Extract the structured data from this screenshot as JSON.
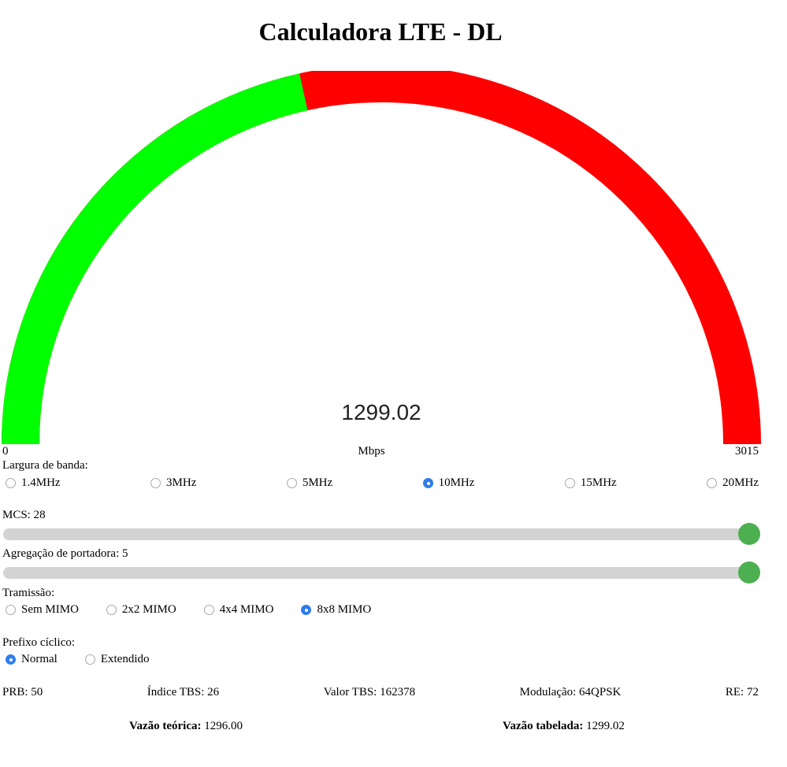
{
  "title": "Calculadora LTE - DL",
  "gauge": {
    "value": 1299.02,
    "display_value": "1299.02",
    "min_label": "0",
    "max_label": "3015",
    "min": 0,
    "max": 3015,
    "unit": "Mbps",
    "fill_color": "#00ff00",
    "remainder_color": "#ff0000"
  },
  "bandwidth": {
    "label": "Largura de banda:",
    "options": [
      "1.4MHz",
      "3MHz",
      "5MHz",
      "10MHz",
      "15MHz",
      "20MHz"
    ],
    "selected": "10MHz"
  },
  "mcs": {
    "label": "MCS: 28",
    "value": 28,
    "min": 0,
    "max": 28
  },
  "carrier_aggregation": {
    "label": "Agregação de portadora: 5",
    "value": 5,
    "min": 1,
    "max": 5
  },
  "transmission": {
    "label": "Tramissão:",
    "options": [
      "Sem MIMO",
      "2x2 MIMO",
      "4x4 MIMO",
      "8x8 MIMO"
    ],
    "selected": "8x8 MIMO"
  },
  "cyclic_prefix": {
    "label": "Prefixo cíclico:",
    "options": [
      "Normal",
      "Extendido"
    ],
    "selected": "Normal"
  },
  "stats": {
    "prb": "PRB: 50",
    "tbs_index": "Índice TBS: 26",
    "tbs_value": "Valor TBS: 162378",
    "modulation": "Modulação: 64QPSK",
    "re": "RE: 72"
  },
  "throughput": {
    "theoretical_label": "Vazão teórica:",
    "theoretical_value": "1296.00",
    "tabulated_label": "Vazão tabelada:",
    "tabulated_value": "1299.02"
  },
  "colors": {
    "accent": "#2f7dec",
    "slider_thumb": "#4caf50",
    "slider_track": "#d3d3d3"
  }
}
